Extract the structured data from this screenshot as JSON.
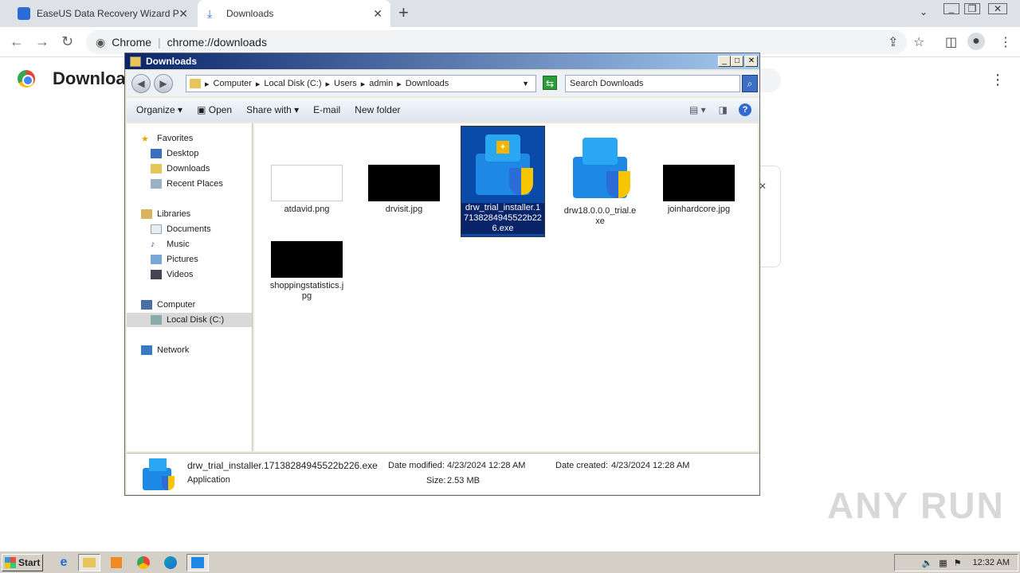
{
  "browser": {
    "tabs": [
      {
        "title": "EaseUS Data Recovery Wizard Profe",
        "active": false
      },
      {
        "title": "Downloads",
        "active": true
      }
    ],
    "omnibox_label": "Chrome",
    "url": "chrome://downloads",
    "page_title": "Downloa"
  },
  "explorer": {
    "window_title": "Downloads",
    "breadcrumb": [
      "Computer",
      "Local Disk (C:)",
      "Users",
      "admin",
      "Downloads"
    ],
    "search_placeholder": "Search Downloads",
    "commands": {
      "organize": "Organize",
      "open": "Open",
      "share": "Share with",
      "email": "E-mail",
      "new_folder": "New folder"
    },
    "nav": {
      "favorites": "Favorites",
      "desktop": "Desktop",
      "downloads": "Downloads",
      "recent": "Recent Places",
      "libraries": "Libraries",
      "documents": "Documents",
      "music": "Music",
      "pictures": "Pictures",
      "videos": "Videos",
      "computer": "Computer",
      "localdisk": "Local Disk (C:)",
      "network": "Network"
    },
    "files": [
      {
        "name_l1": "atdavid.png",
        "name_l2": ""
      },
      {
        "name_l1": "drvisit.jpg",
        "name_l2": ""
      },
      {
        "name_l1": "drw_trial_installer.1",
        "name_l2": "7138284945522b22",
        "name_l3": "6.exe",
        "selected": true
      },
      {
        "name_l1": "drw18.0.0.0_trial.e",
        "name_l2": "xe"
      },
      {
        "name_l1": "joinhardcore.jpg",
        "name_l2": ""
      },
      {
        "name_l1": "shoppingstatistics.j",
        "name_l2": "pg"
      }
    ],
    "details": {
      "filename": "drw_trial_installer.17138284945522b226.exe",
      "type": "Application",
      "modified_label": "Date modified:",
      "modified": "4/23/2024 12:28 AM",
      "created_label": "Date created:",
      "created": "4/23/2024 12:28 AM",
      "size_label": "Size:",
      "size": "2.53 MB"
    }
  },
  "taskbar": {
    "start": "Start",
    "time": "12:32 AM"
  },
  "watermark": "ANY RUN"
}
